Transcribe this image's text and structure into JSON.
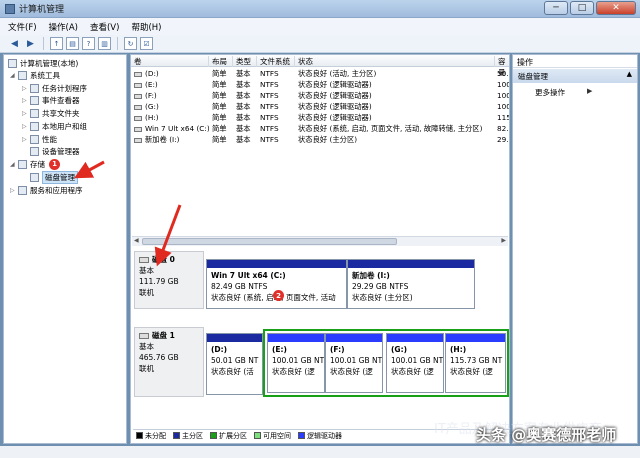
{
  "window": {
    "title": "计算机管理",
    "buttons": {
      "minimize": "─",
      "maximize": "□",
      "close": "✕"
    }
  },
  "menu": [
    "文件(F)",
    "操作(A)",
    "查看(V)",
    "帮助(H)"
  ],
  "tree": {
    "root": "计算机管理(本地)",
    "system_tools": "系统工具",
    "task_scheduler": "任务计划程序",
    "event_viewer": "事件查看器",
    "shared_folders": "共享文件夹",
    "local_users": "本地用户和组",
    "performance": "性能",
    "device_manager": "设备管理器",
    "storage": "存储",
    "disk_management": "磁盘管理",
    "services": "服务和应用程序"
  },
  "annotations": {
    "badge1": "1",
    "badge2": "2"
  },
  "volume_list": {
    "headers": [
      "卷",
      "布局",
      "类型",
      "文件系统",
      "状态",
      "容量"
    ],
    "rows": [
      [
        "(D:)",
        "简单",
        "基本",
        "NTFS",
        "状态良好 (活动, 主分区)",
        "50.0"
      ],
      [
        "(E:)",
        "简单",
        "基本",
        "NTFS",
        "状态良好 (逻辑驱动器)",
        "100."
      ],
      [
        "(F:)",
        "简单",
        "基本",
        "NTFS",
        "状态良好 (逻辑驱动器)",
        "100."
      ],
      [
        "(G:)",
        "简单",
        "基本",
        "NTFS",
        "状态良好 (逻辑驱动器)",
        "100."
      ],
      [
        "(H:)",
        "简单",
        "基本",
        "NTFS",
        "状态良好 (逻辑驱动器)",
        "115"
      ],
      [
        "Win 7 Ult x64 (C:)",
        "简单",
        "基本",
        "NTFS",
        "状态良好 (系统, 启动, 页面文件, 活动, 故障转储, 主分区)",
        "82.4"
      ],
      [
        "新加卷 (I:)",
        "简单",
        "基本",
        "NTFS",
        "状态良好 (主分区)",
        "29.2"
      ]
    ]
  },
  "disks": [
    {
      "name": "磁盘 0",
      "type": "基本",
      "size": "111.79 GB",
      "status": "联机",
      "partitions": [
        {
          "name": "Win 7 Ult x64  (C:)",
          "size": "82.49 GB NTFS",
          "status": "状态良好 (系统, 启动, 页面文件, 活动"
        },
        {
          "name": "新加卷  (I:)",
          "size": "29.29 GB NTFS",
          "status": "状态良好 (主分区)"
        }
      ]
    },
    {
      "name": "磁盘 1",
      "type": "基本",
      "size": "465.76 GB",
      "status": "联机",
      "partitions": [
        {
          "name": "(D:)",
          "size": "50.01 GB NT",
          "status": "状态良好 (活"
        },
        {
          "name": "(E:)",
          "size": "100.01 GB NT",
          "status": "状态良好 (逻"
        },
        {
          "name": "(F:)",
          "size": "100.01 GB NT",
          "status": "状态良好 (逻"
        },
        {
          "name": "(G:)",
          "size": "100.01 GB NT",
          "status": "状态良好 (逻"
        },
        {
          "name": "(H:)",
          "size": "115.73 GB NT",
          "status": "状态良好 (逻"
        }
      ]
    }
  ],
  "legend": [
    {
      "label": "未分配",
      "color": "#000000"
    },
    {
      "label": "主分区",
      "color": "#1b2aa0"
    },
    {
      "label": "扩展分区",
      "color": "#19a019"
    },
    {
      "label": "可用空间",
      "color": "#7ce07c"
    },
    {
      "label": "逻辑驱动器",
      "color": "#2a3cff"
    }
  ],
  "actions": {
    "header": "操作",
    "section": "磁盘管理",
    "more": "更多操作"
  },
  "watermark": {
    "line1": "IT产品及解决方案专业供应商",
    "line2": "头条 @奥赛德邢老师"
  }
}
